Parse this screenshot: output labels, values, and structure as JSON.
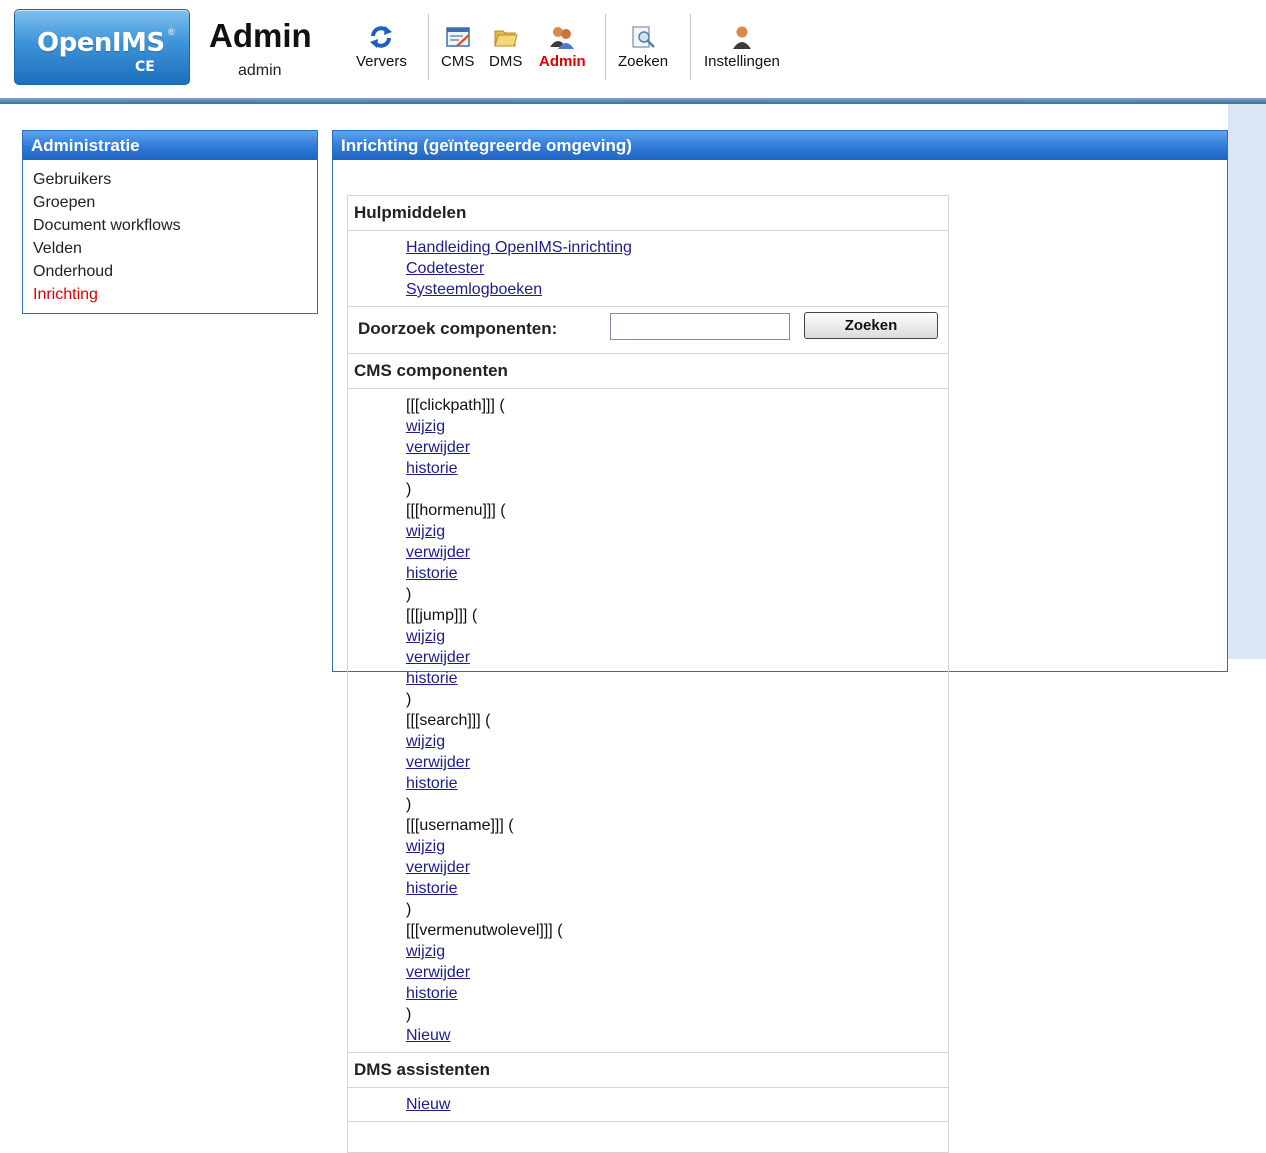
{
  "app": {
    "logo_name": "OpenIMS",
    "logo_registered": "®",
    "logo_edition": "CE",
    "title": "Admin",
    "user": "admin"
  },
  "toolbar": [
    {
      "key": "ververs",
      "label": "Ververs",
      "icon": "refresh-icon"
    },
    {
      "key": "cms",
      "label": "CMS",
      "icon": "cms-editor-icon"
    },
    {
      "key": "dms",
      "label": "DMS",
      "icon": "folders-icon"
    },
    {
      "key": "admin",
      "label": "Admin",
      "icon": "admin-users-icon",
      "active": true
    },
    {
      "key": "zoeken",
      "label": "Zoeken",
      "icon": "search-document-icon"
    },
    {
      "key": "instellingen",
      "label": "Instellingen",
      "icon": "user-settings-icon"
    }
  ],
  "sidebar": {
    "title": "Administratie",
    "items": [
      {
        "label": "Gebruikers"
      },
      {
        "label": "Groepen"
      },
      {
        "label": "Document workflows"
      },
      {
        "label": "Velden"
      },
      {
        "label": "Onderhoud"
      },
      {
        "label": "Inrichting",
        "current": true
      }
    ]
  },
  "main": {
    "title": "Inrichting (geïntegreerde omgeving)",
    "tools": {
      "heading": "Hulpmiddelen",
      "links": [
        "Handleiding OpenIMS-inrichting",
        "Codetester",
        "Systeemlogboeken"
      ]
    },
    "search": {
      "label": "Doorzoek componenten:",
      "value": "",
      "button": "Zoeken"
    },
    "cms": {
      "heading": "CMS componenten",
      "components": [
        "[[[clickpath]]]",
        "[[[hormenu]]]",
        "[[[jump]]]",
        "[[[search]]]",
        "[[[username]]]",
        "[[[vermenutwolevel]]]"
      ],
      "actions": {
        "edit": "wijzig",
        "delete": "verwijder",
        "history": "historie"
      },
      "new_label": "Nieuw"
    },
    "dms": {
      "heading": "DMS assistenten",
      "new_label": "Nieuw"
    }
  },
  "colors": {
    "accent_blue": "#2f7ad8",
    "active_red": "#e10000",
    "link": "#1d1d8c"
  }
}
